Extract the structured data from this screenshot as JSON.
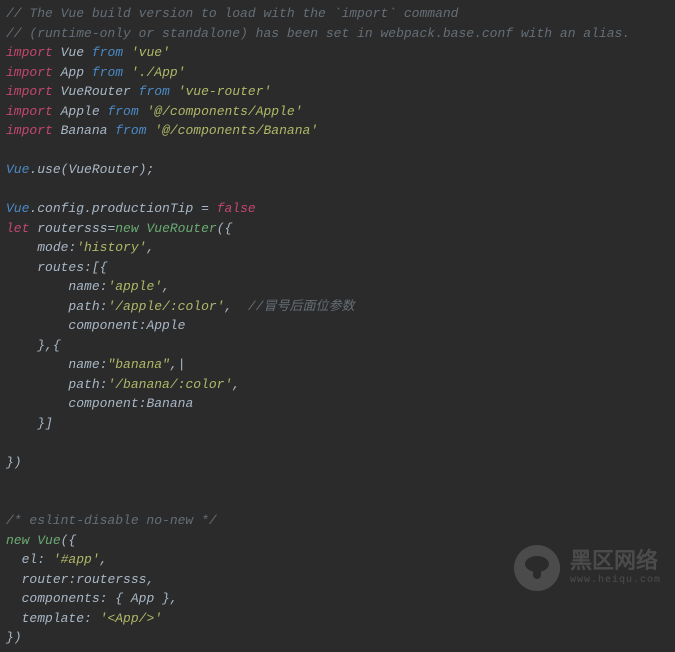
{
  "c1": "// The Vue build version to load with the `import` command",
  "c2": "// (runtime-only or standalone) has been set in webpack.base.conf with an alias.",
  "kw_import": "import",
  "kw_from": "from",
  "kw_let": "let",
  "kw_new": "new",
  "Vue": "Vue",
  "App": "App",
  "VueRouter": "VueRouter",
  "Apple": "Apple",
  "Banana": "Banana",
  "s_vue": "'vue'",
  "s_app": "'./App'",
  "s_vr": "'vue-router'",
  "s_apple_c": "'@/components/Apple'",
  "s_banana_c": "'@/components/Banana'",
  "use": "use",
  "config": "config",
  "productionTip": "productionTip",
  "false": "false",
  "routersss": "routersss",
  "mode_k": "mode",
  "mode_v": "'history'",
  "routes_k": "routes",
  "name_k": "name",
  "path_k": "path",
  "component_k": "component",
  "apple_name": "'apple'",
  "apple_path": "'/apple/:color'",
  "apple_cmt": "//冒号后面位参数",
  "banana_name": "\"banana\"",
  "banana_path": "'/banana/:color'",
  "c3": "/* eslint-disable no-new */",
  "el_k": "el",
  "el_v": "'#app'",
  "router_k": "router",
  "components_k": "components",
  "template_k": "template",
  "template_v": "'<App/>'",
  "wm_cn": "黑区网络",
  "wm_en": "www.heiqu.com"
}
